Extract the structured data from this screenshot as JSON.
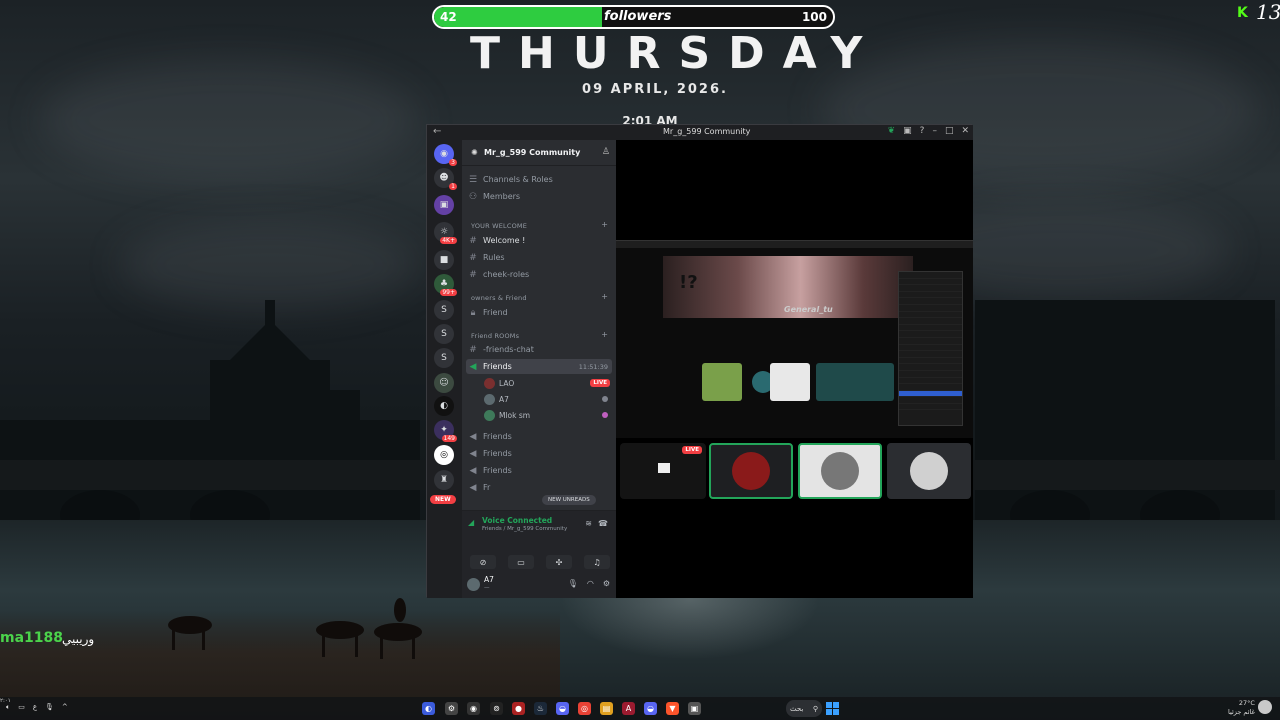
{
  "overlay": {
    "followers_current": "42",
    "followers_label": "followers",
    "followers_goal": "100",
    "followers_progress": 0.42,
    "day": "THURSDAY",
    "date": "09 APRIL, 2026.",
    "time": "2:01 AM",
    "corner_number": "13",
    "chat_user": "ma1188",
    "chat_message": "وريبيي"
  },
  "window": {
    "title": "Mr_g_599 Community"
  },
  "guilds": {
    "badges": [
      "3",
      "1",
      "4K+",
      "99+",
      "149"
    ],
    "letters": [
      "S",
      "S",
      "S"
    ],
    "new_label": "NEW"
  },
  "sidebar": {
    "server_name": "Mr_g_599 Community",
    "channels_roles": "Channels & Roles",
    "members": "Members",
    "cat_welcome": "YOUR WELCOME",
    "welcome": "Welcome !",
    "rules": "Rules",
    "cheek_roles": "cheek-roles",
    "cat_owners": "owners & Friend",
    "friend": "Friend",
    "cat_rooms": "Friend ROOMs",
    "friends_chat": "-friends-chat",
    "vc_friends": "Friends",
    "vc_time": "11:51:39",
    "member_1": "LAO",
    "member_2": "A7",
    "member_3": "Mlok",
    "member_3_suffix": "sm",
    "live": "LIVE",
    "vc_2": "Friends",
    "vc_3": "Friends",
    "vc_4": "Friends",
    "vc_5": "Fr",
    "new_unreads": "NEW UNREADS"
  },
  "voice": {
    "status": "Voice Connected",
    "location": "Friends / Mr_g_599 Community"
  },
  "user": {
    "name": "A7",
    "status": "—"
  },
  "stage": {
    "art_signature": "General_tu",
    "art_mark": "!?",
    "tile_live": "LIVE"
  },
  "taskbar": {
    "search": "بحث",
    "weather_temp": "27°C",
    "weather_text": "غائم جزئيا",
    "clock": "٢:٠١"
  },
  "colors": {
    "accent_green": "#2ecc40",
    "discord_green": "#23a55a",
    "live_red": "#f23f43",
    "blurple": "#5865f2"
  }
}
